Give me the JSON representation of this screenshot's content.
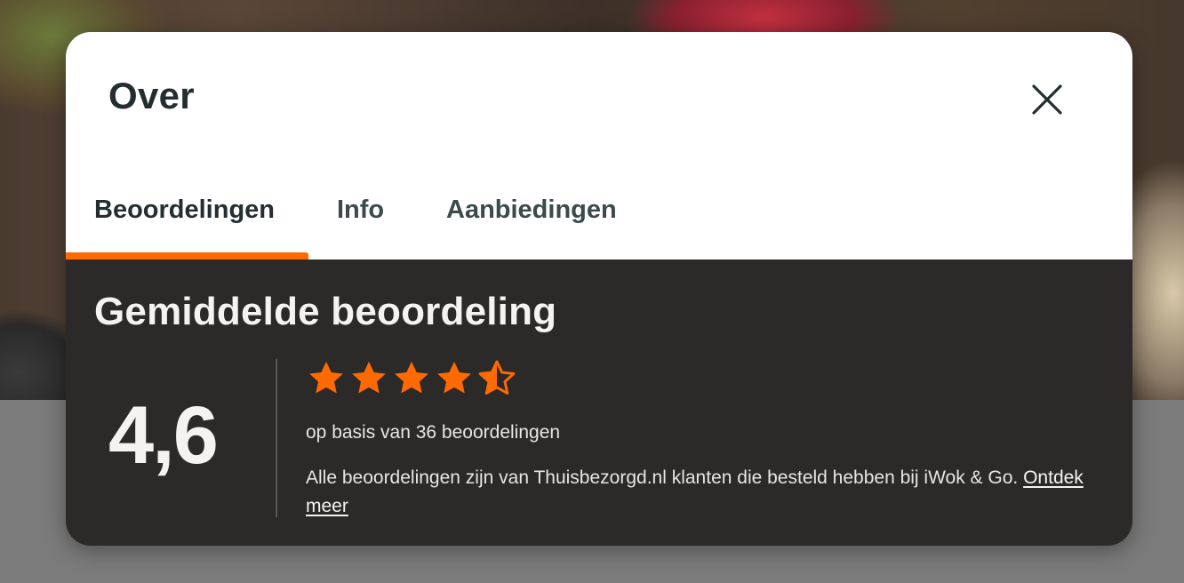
{
  "modal": {
    "title": "Over",
    "close_icon": "close-icon"
  },
  "tabs": [
    {
      "label": "Beoordelingen",
      "active": true
    },
    {
      "label": "Info",
      "active": false
    },
    {
      "label": "Aanbiedingen",
      "active": false
    }
  ],
  "reviews": {
    "section_title": "Gemiddelde beoordeling",
    "average": "4,6",
    "stars_value": 4.5,
    "stars_max": 5,
    "basis_text": "op basis van 36 beoordelingen",
    "note_text": "Alle beoordelingen zijn van Thuisbezorgd.nl klanten die besteld hebben bij iWok & Go.",
    "note_link": "Ontdek meer"
  },
  "colors": {
    "accent": "#ff6a00",
    "panel_dark": "#2b2a29",
    "heading_dark": "#242e30"
  }
}
